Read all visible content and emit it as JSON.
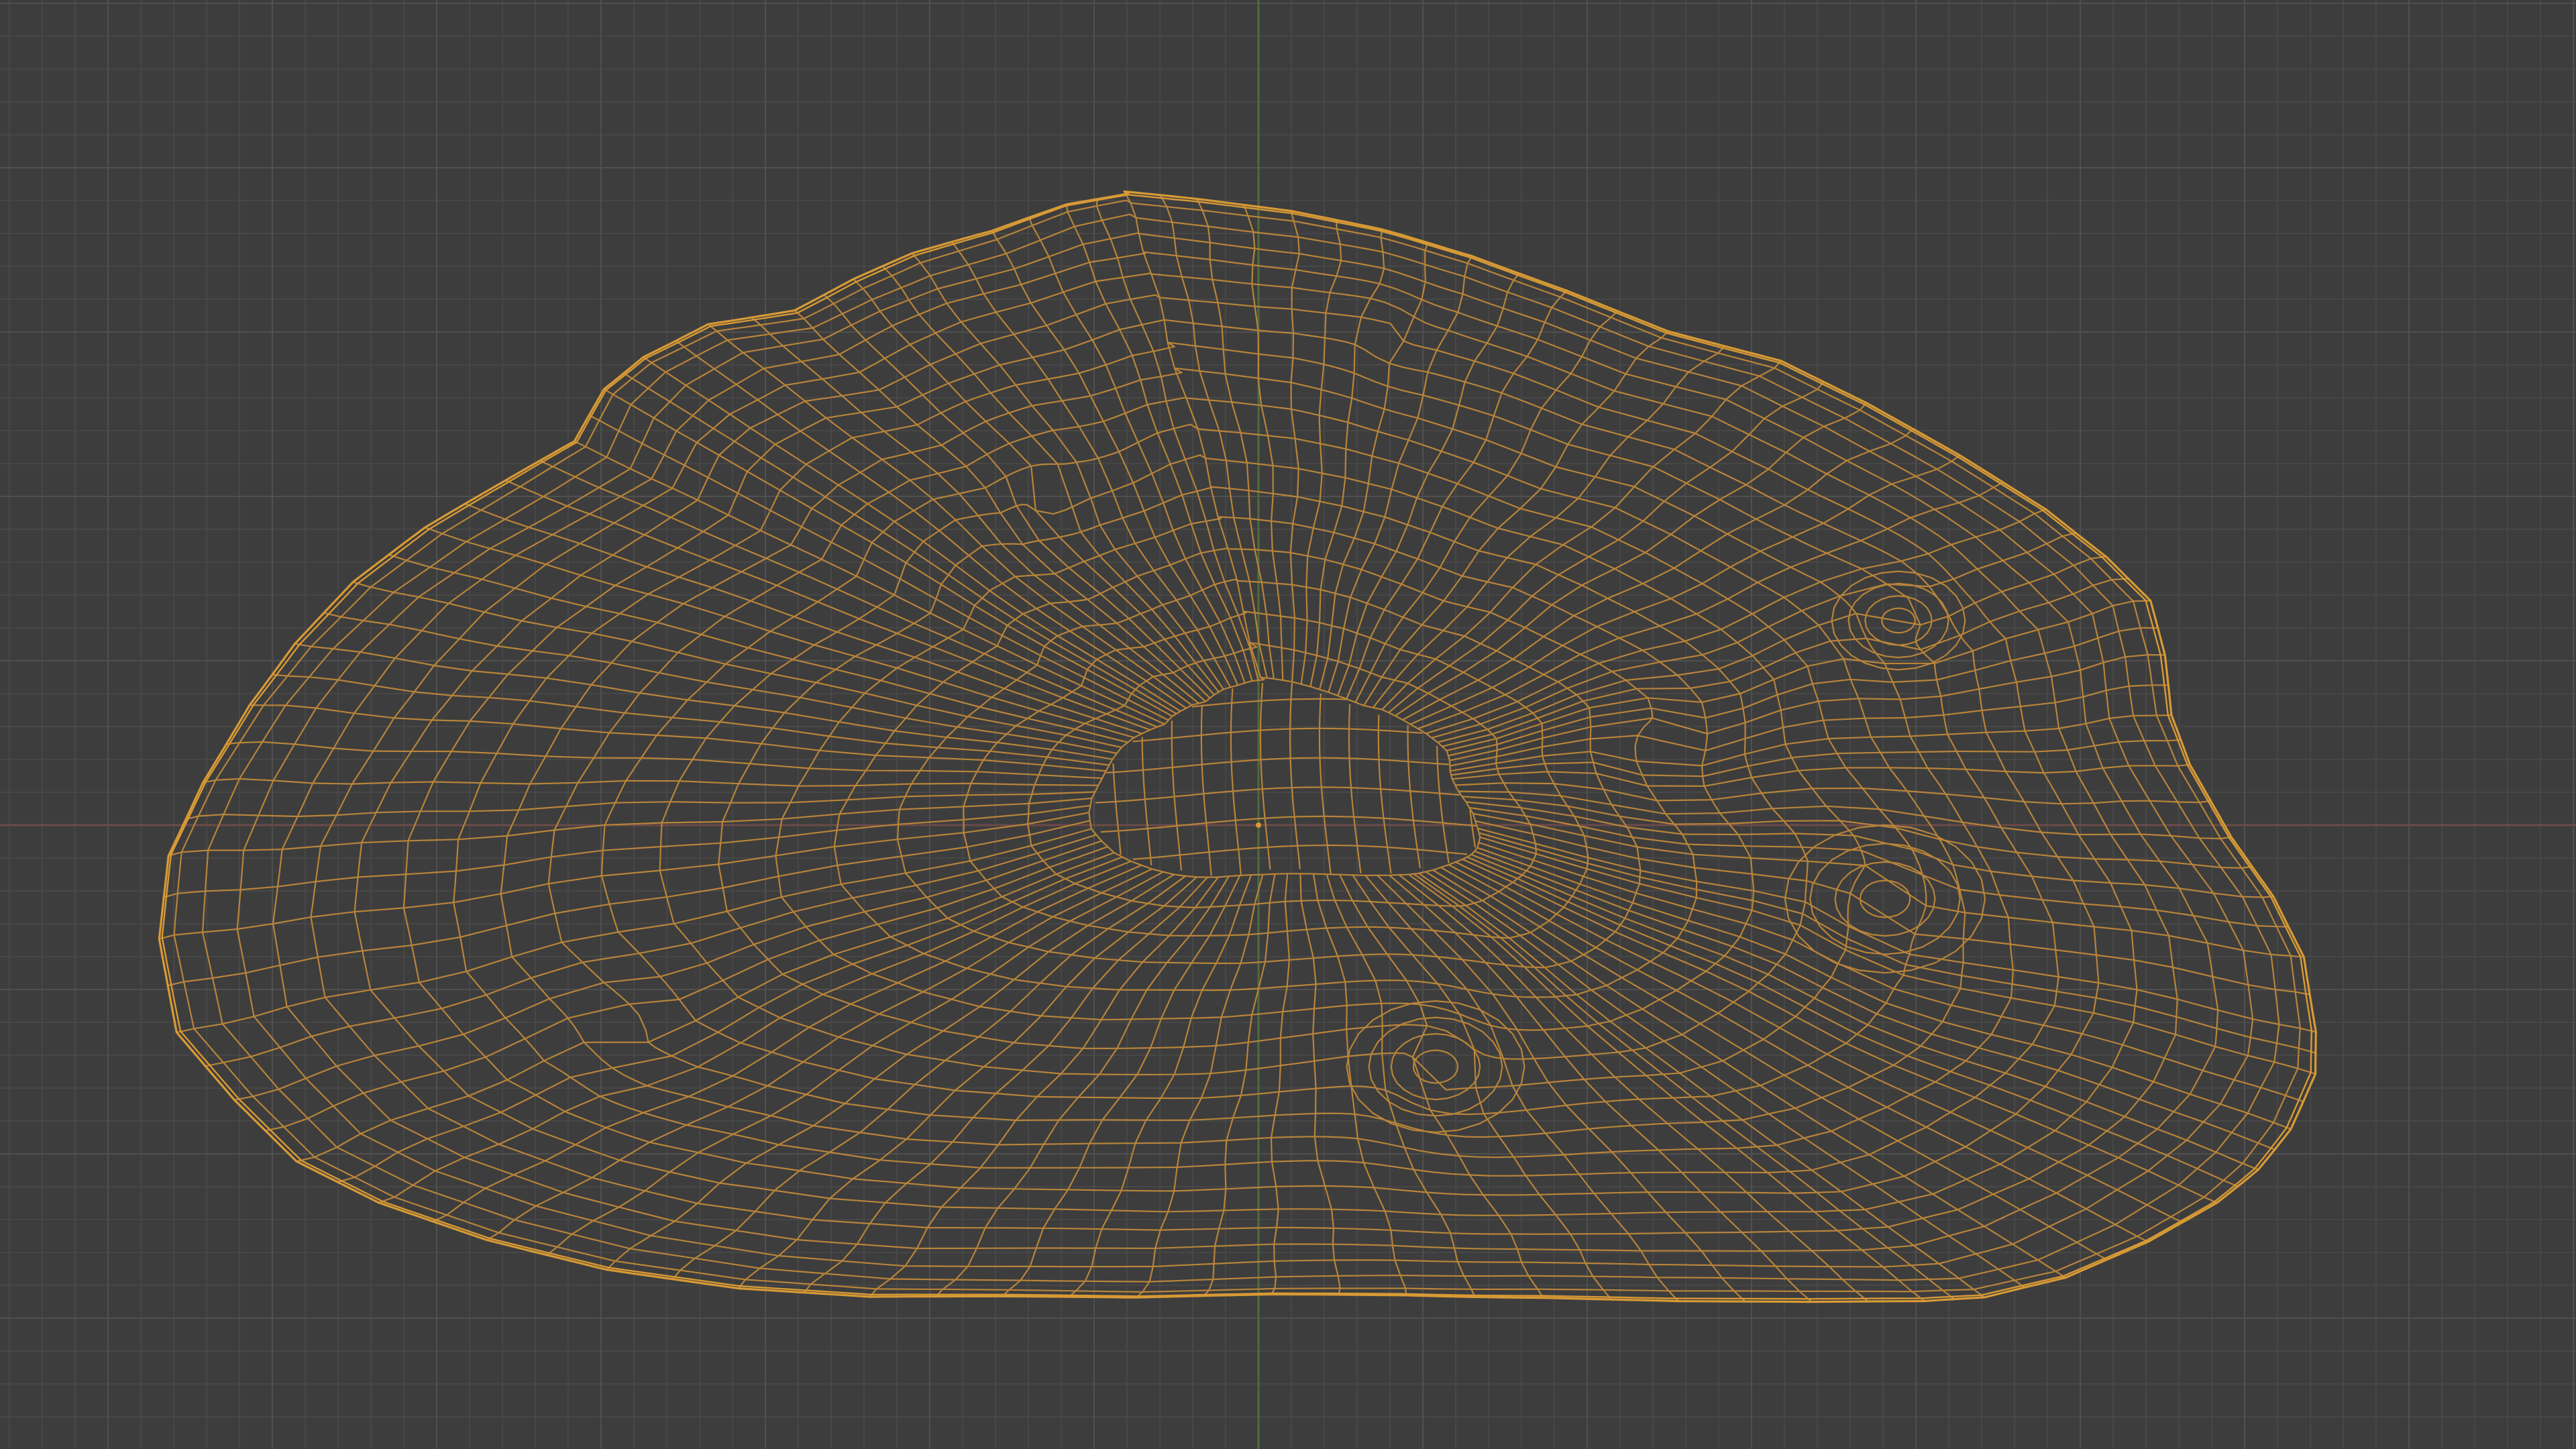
{
  "viewport": {
    "view": "orthographic-front",
    "shading_mode": "wireframe",
    "grid_visible": true,
    "object_selected": true,
    "has_visible_text": false
  },
  "colors": {
    "background": "#3d3d3d",
    "grid_minor": "#474747",
    "grid_major": "#505050",
    "axis_x": "#6b4a48",
    "axis_z": "#4f6b3f",
    "wireframe_selected": "#d89a35",
    "wireframe_interior": "#b8843a"
  },
  "icons": {
    "origin_point": "object-origin-dot"
  }
}
